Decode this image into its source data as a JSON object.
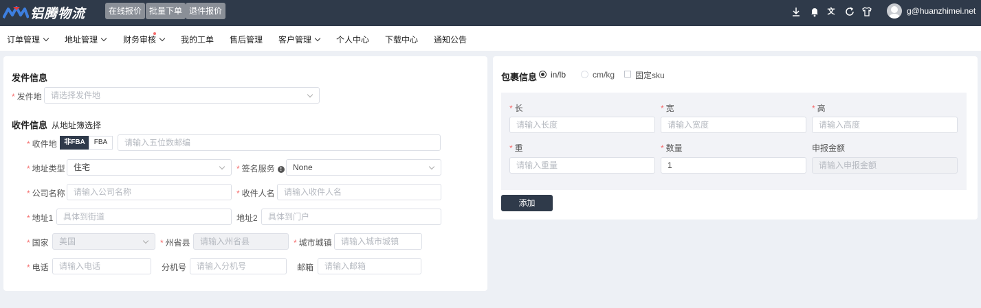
{
  "header": {
    "logo_text": "铝腾物流",
    "buttons": [
      "在线报价",
      "批量下单",
      "退件报价"
    ],
    "icons": [
      "download-icon",
      "bell-icon",
      "translate-icon",
      "refresh-icon",
      "shirt-icon"
    ],
    "user_email": "g@huanzhimei.net"
  },
  "nav": {
    "items": [
      "订单管理",
      "地址管理",
      "财务审核",
      "我的工单",
      "售后管理",
      "客户管理",
      "个人中心",
      "下载中心",
      "通知公告"
    ]
  },
  "sender": {
    "title": "发件信息",
    "origin_label": "发件地",
    "origin_placeholder": "请选择发件地"
  },
  "receiver": {
    "title": "收件信息",
    "address_book_link": "从地址簿选择",
    "dest_label": "收件地",
    "seg_non_fba": "非FBA",
    "seg_fba": "FBA",
    "zip_placeholder": "请输入五位数邮编",
    "addr_type_label": "地址类型",
    "addr_type_value": "住宅",
    "signature_label": "签名服务",
    "signature_value": "None",
    "company_label": "公司名称",
    "company_placeholder": "请输入公司名称",
    "recipient_label": "收件人名",
    "recipient_placeholder": "请输入收件人名",
    "addr1_label": "地址1",
    "addr1_placeholder": "具体到街道",
    "addr2_label": "地址2",
    "addr2_placeholder": "具体到门户",
    "country_label": "国家",
    "country_value": "美国",
    "state_label": "州省县",
    "state_placeholder": "请输入州省县",
    "city_label": "城市城镇",
    "city_placeholder": "请输入城市城镇",
    "phone_label": "电话",
    "phone_placeholder": "请输入电话",
    "ext_label": "分机号",
    "ext_placeholder": "请输入分机号",
    "email_label": "邮箱",
    "email_placeholder": "请输入邮箱"
  },
  "package": {
    "title": "包裹信息",
    "unit_inlb": "in/lb",
    "unit_cmkg": "cm/kg",
    "fixed_sku": "固定sku",
    "selected_unit": "in/lb",
    "length_label": "长",
    "length_placeholder": "请输入长度",
    "width_label": "宽",
    "width_placeholder": "请输入宽度",
    "height_label": "高",
    "height_placeholder": "请输入高度",
    "weight_label": "重",
    "weight_placeholder": "请输入重量",
    "qty_label": "数量",
    "qty_value": "1",
    "declared_label": "申报金额",
    "declared_placeholder": "请输入申报金额",
    "add_button": "添加"
  },
  "colors": {
    "header_bg": "#2f3a4a",
    "required": "#f56c6c",
    "page_bg": "#edf0f5"
  }
}
